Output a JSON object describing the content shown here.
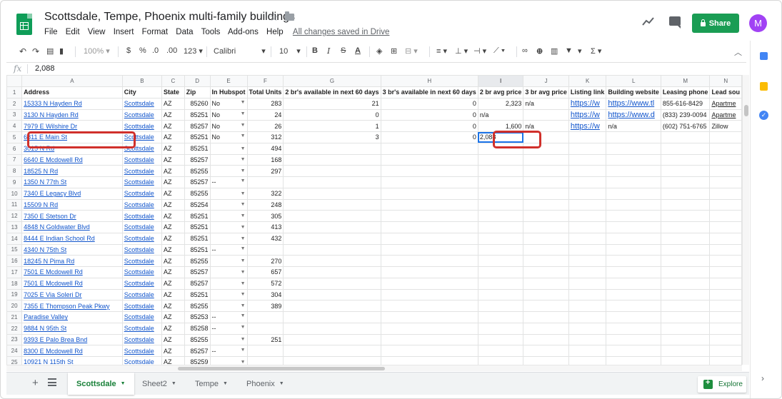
{
  "header": {
    "title": "Scottsdale, Tempe, Phoenix multi-family buildings",
    "menu": [
      "File",
      "Edit",
      "View",
      "Insert",
      "Format",
      "Data",
      "Tools",
      "Add-ons",
      "Help"
    ],
    "saved_status": "All changes saved in Drive",
    "share_label": "Share",
    "avatar_initial": "M",
    "icons": [
      "trending-icon",
      "comment-icon",
      "star-icon",
      "folder-icon",
      "lock-icon"
    ]
  },
  "toolbar": {
    "zoom": "100%",
    "currency": "$",
    "percent": "%",
    "decrease_decimal": ".0",
    "increase_decimal": ".00",
    "more_formats": "123",
    "font": "Calibri",
    "font_size": "10",
    "bold": "B",
    "italic": "I",
    "strike": "S",
    "text_color": "A",
    "sigma": "Σ"
  },
  "formula": {
    "fx": "fx",
    "value": "2,088"
  },
  "columns": [
    "A",
    "B",
    "C",
    "D",
    "E",
    "F",
    "G",
    "H",
    "I",
    "J",
    "K",
    "L",
    "M",
    "N"
  ],
  "selected_column": "I",
  "headers": [
    "Address",
    "City",
    "State",
    "Zip",
    "In Hubspot",
    "Total Units",
    "2 br's available in next 60 days",
    "3 br's available in next 60 days",
    "2 br avg price",
    "3 br avg price",
    "Listing link",
    "Building website",
    "Leasing phone",
    "Lead sou"
  ],
  "rows": [
    {
      "n": "2",
      "address": "15333 N Hayden Rd",
      "city": "Scottsdale",
      "state": "AZ",
      "zip": "85260",
      "hub": "No",
      "units": "283",
      "g": "21",
      "h": "0",
      "i": "2,323",
      "j": "n/a",
      "k": "https://w",
      "l": "https://www.tl",
      "m": "855-616-8429",
      "n2": "Apartme"
    },
    {
      "n": "3",
      "address": "3130 N Hayden Rd",
      "city": "Scottsdale",
      "state": "AZ",
      "zip": "85251",
      "hub": "No",
      "units": "24",
      "g": "0",
      "h": "0",
      "i": "n/a",
      "j": "",
      "k": "https://w",
      "l": "https://www.d",
      "m": "(833) 239-0094",
      "n2": "Apartme"
    },
    {
      "n": "4",
      "address": "7979 E Wilshire Dr",
      "city": "Scottsdale",
      "state": "AZ",
      "zip": "85257",
      "hub": "No",
      "units": "26",
      "g": "1",
      "h": "0",
      "i": "1,600",
      "j": "n/a",
      "k": "https://w",
      "l": "n/a",
      "m": "(602) 751-6765",
      "n2": "Zillow"
    },
    {
      "n": "5",
      "address": "6811 E Main St",
      "city": "Scottsdale",
      "state": "AZ",
      "zip": "85251",
      "hub": "No",
      "units": "312",
      "g": "3",
      "h": "0",
      "i": "2,088",
      "j": "",
      "k": "",
      "l": "",
      "m": "",
      "n2": ""
    },
    {
      "n": "6",
      "address": "3015 N  Rd",
      "city": "Scottsdale",
      "state": "AZ",
      "zip": "85251",
      "hub": "",
      "units": "494",
      "g": "",
      "h": "",
      "i": "",
      "j": "",
      "k": "",
      "l": "",
      "m": "",
      "n2": ""
    },
    {
      "n": "7",
      "address": "6640 E Mcdowell Rd",
      "city": "Scottsdale",
      "state": "AZ",
      "zip": "85257",
      "hub": "",
      "units": "168",
      "g": "",
      "h": "",
      "i": "",
      "j": "",
      "k": "",
      "l": "",
      "m": "",
      "n2": ""
    },
    {
      "n": "8",
      "address": "18525 N  Rd",
      "city": "Scottsdale",
      "state": "AZ",
      "zip": "85255",
      "hub": "",
      "units": "297",
      "g": "",
      "h": "",
      "i": "",
      "j": "",
      "k": "",
      "l": "",
      "m": "",
      "n2": ""
    },
    {
      "n": "9",
      "address": "1350 N 77th St",
      "city": "Scottsdale",
      "state": "AZ",
      "zip": "85257",
      "hub": "--",
      "units": "",
      "g": "",
      "h": "",
      "i": "",
      "j": "",
      "k": "",
      "l": "",
      "m": "",
      "n2": ""
    },
    {
      "n": "10",
      "address": "7340 E Legacy Blvd",
      "city": "Scottsdale",
      "state": "AZ",
      "zip": "85255",
      "hub": "",
      "units": "322",
      "g": "",
      "h": "",
      "i": "",
      "j": "",
      "k": "",
      "l": "",
      "m": "",
      "n2": ""
    },
    {
      "n": "11",
      "address": "15509 N  Rd",
      "city": "Scottsdale",
      "state": "AZ",
      "zip": "85254",
      "hub": "",
      "units": "248",
      "g": "",
      "h": "",
      "i": "",
      "j": "",
      "k": "",
      "l": "",
      "m": "",
      "n2": ""
    },
    {
      "n": "12",
      "address": "7350 E Stetson Dr",
      "city": "Scottsdale",
      "state": "AZ",
      "zip": "85251",
      "hub": "",
      "units": "305",
      "g": "",
      "h": "",
      "i": "",
      "j": "",
      "k": "",
      "l": "",
      "m": "",
      "n2": ""
    },
    {
      "n": "13",
      "address": "4848 N Goldwater Blvd",
      "city": "Scottsdale",
      "state": "AZ",
      "zip": "85251",
      "hub": "",
      "units": "413",
      "g": "",
      "h": "",
      "i": "",
      "j": "",
      "k": "",
      "l": "",
      "m": "",
      "n2": ""
    },
    {
      "n": "14",
      "address": "8444 E Indian School Rd",
      "city": "Scottsdale",
      "state": "AZ",
      "zip": "85251",
      "hub": "",
      "units": "432",
      "g": "",
      "h": "",
      "i": "",
      "j": "",
      "k": "",
      "l": "",
      "m": "",
      "n2": ""
    },
    {
      "n": "15",
      "address": "4340 N 75th St",
      "city": "Scottsdale",
      "state": "AZ",
      "zip": "85251",
      "hub": "--",
      "units": "",
      "g": "",
      "h": "",
      "i": "",
      "j": "",
      "k": "",
      "l": "",
      "m": "",
      "n2": ""
    },
    {
      "n": "16",
      "address": "18245 N Pima Rd",
      "city": "Scottsdale",
      "state": "AZ",
      "zip": "85255",
      "hub": "",
      "units": "270",
      "g": "",
      "h": "",
      "i": "",
      "j": "",
      "k": "",
      "l": "",
      "m": "",
      "n2": ""
    },
    {
      "n": "17",
      "address": "7501 E Mcdowell Rd",
      "city": "Scottsdale",
      "state": "AZ",
      "zip": "85257",
      "hub": "",
      "units": "657",
      "g": "",
      "h": "",
      "i": "",
      "j": "",
      "k": "",
      "l": "",
      "m": "",
      "n2": ""
    },
    {
      "n": "18",
      "address": "7501 E Mcdowell Rd",
      "city": "Scottsdale",
      "state": "AZ",
      "zip": "85257",
      "hub": "",
      "units": "572",
      "g": "",
      "h": "",
      "i": "",
      "j": "",
      "k": "",
      "l": "",
      "m": "",
      "n2": ""
    },
    {
      "n": "19",
      "address": "7025 E Via Soleri Dr",
      "city": "Scottsdale",
      "state": "AZ",
      "zip": "85251",
      "hub": "",
      "units": "304",
      "g": "",
      "h": "",
      "i": "",
      "j": "",
      "k": "",
      "l": "",
      "m": "",
      "n2": ""
    },
    {
      "n": "20",
      "address": "7355 E Thompson Peak Pkwy",
      "city": "Scottsdale",
      "state": "AZ",
      "zip": "85255",
      "hub": "",
      "units": "389",
      "g": "",
      "h": "",
      "i": "",
      "j": "",
      "k": "",
      "l": "",
      "m": "",
      "n2": ""
    },
    {
      "n": "21",
      "address": "Paradise Valley",
      "city": "Scottsdale",
      "state": "AZ",
      "zip": "85253",
      "hub": "--",
      "units": "",
      "g": "",
      "h": "",
      "i": "",
      "j": "",
      "k": "",
      "l": "",
      "m": "",
      "n2": ""
    },
    {
      "n": "22",
      "address": "9884 N 95th St",
      "city": "Scottsdale",
      "state": "AZ",
      "zip": "85258",
      "hub": "--",
      "units": "",
      "g": "",
      "h": "",
      "i": "",
      "j": "",
      "k": "",
      "l": "",
      "m": "",
      "n2": ""
    },
    {
      "n": "23",
      "address": "9393 E Palo Brea Bnd",
      "city": "Scottsdale",
      "state": "AZ",
      "zip": "85255",
      "hub": "",
      "units": "251",
      "g": "",
      "h": "",
      "i": "",
      "j": "",
      "k": "",
      "l": "",
      "m": "",
      "n2": ""
    },
    {
      "n": "24",
      "address": "8300 E Mcdowell Rd",
      "city": "Scottsdale",
      "state": "AZ",
      "zip": "85257",
      "hub": "--",
      "units": "",
      "g": "",
      "h": "",
      "i": "",
      "j": "",
      "k": "",
      "l": "",
      "m": "",
      "n2": ""
    },
    {
      "n": "25",
      "address": "10921 N 115th St",
      "city": "Scottsdale",
      "state": "AZ",
      "zip": "85259",
      "hub": "",
      "units": "",
      "g": "",
      "h": "",
      "i": "",
      "j": "",
      "k": "",
      "l": "",
      "m": "",
      "n2": ""
    }
  ],
  "tabs": [
    {
      "label": "Scottsdale",
      "active": true
    },
    {
      "label": "Sheet2",
      "active": false
    },
    {
      "label": "Tempe",
      "active": false
    },
    {
      "label": "Phoenix",
      "active": false
    }
  ],
  "explore_label": "Explore",
  "colors": {
    "brand_green": "#0f9d58",
    "share_green": "#1a9d54",
    "link_blue": "#1155cc",
    "callout_red": "#d0302b",
    "active_tab_green": "#188038"
  }
}
